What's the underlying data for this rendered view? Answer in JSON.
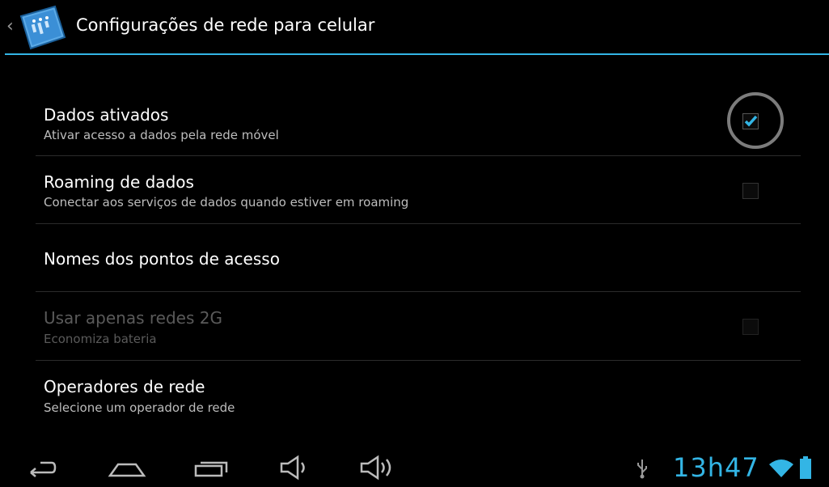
{
  "actionbar": {
    "title": "Configurações de rede para celular",
    "icon": "settings-app-icon",
    "up_icon": "chevron-left-icon"
  },
  "settings": [
    {
      "title": "Dados ativados",
      "summary": "Ativar acesso a dados pela rede móvel",
      "checkbox": true,
      "checked": true,
      "enabled": true
    },
    {
      "title": "Roaming de dados",
      "summary": "Conectar aos serviços de dados quando estiver em roaming",
      "checkbox": true,
      "checked": false,
      "enabled": true
    },
    {
      "title": "Nomes dos pontos de acesso",
      "summary": "",
      "checkbox": false,
      "enabled": true
    },
    {
      "title": "Usar apenas redes 2G",
      "summary": "Economiza bateria",
      "checkbox": true,
      "checked": false,
      "enabled": false
    },
    {
      "title": "Operadores de rede",
      "summary": "Selecione um operador de rede",
      "checkbox": false,
      "enabled": true
    }
  ],
  "navbar": {
    "buttons": [
      "back-icon",
      "home-icon",
      "recent-apps-icon",
      "volume-down-icon",
      "volume-up-icon"
    ],
    "status_icons": [
      "usb-icon",
      "wifi-icon",
      "battery-icon"
    ],
    "clock": "13h47"
  },
  "colors": {
    "accent": "#33b5e5",
    "background": "#000000"
  }
}
